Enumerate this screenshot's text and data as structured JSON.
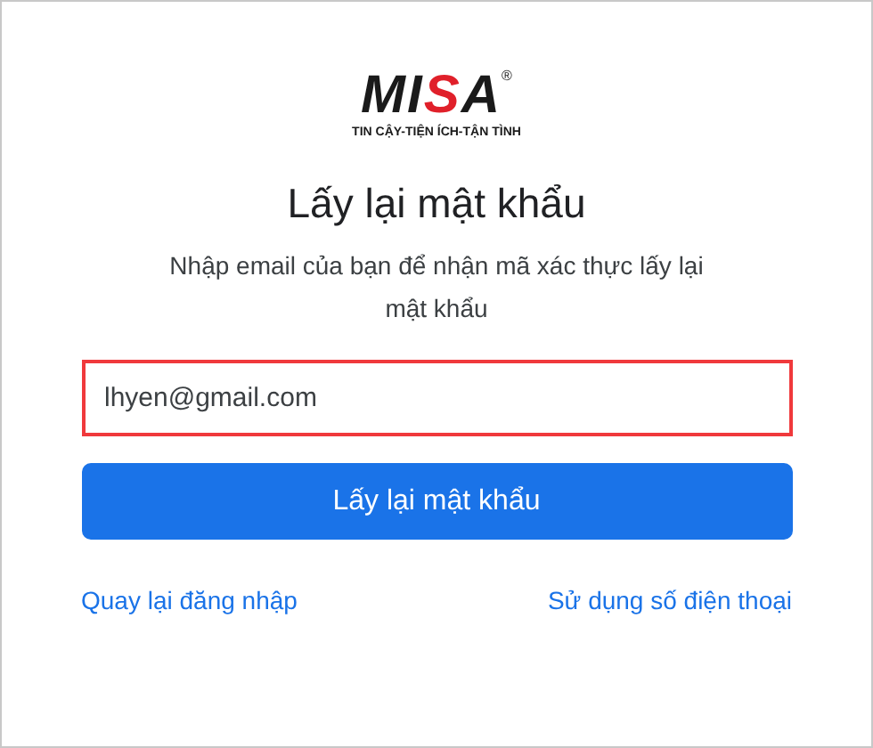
{
  "logo": {
    "wordmark": "MISA",
    "registered": "®",
    "tagline": "TIN CẬY-TIỆN ÍCH-TẬN TÌNH"
  },
  "title": "Lấy lại mật khẩu",
  "subtitle": "Nhập email của bạn để nhận mã xác thực lấy lại mật khẩu",
  "email_field": {
    "value": "lhyen@gmail.com",
    "highlighted": true
  },
  "submit_button": "Lấy lại mật khẩu",
  "links": [
    "Quay lại đăng nhập",
    "Sử dụng số điện thoại"
  ]
}
